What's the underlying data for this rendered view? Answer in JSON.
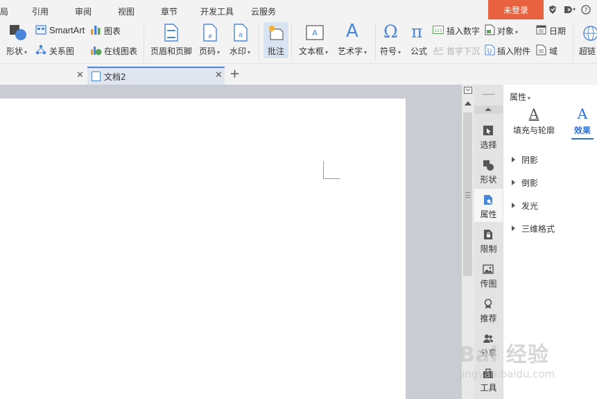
{
  "menu": {
    "items": [
      "布局",
      "引用",
      "审阅",
      "视图",
      "章节",
      "开发工具",
      "云服务"
    ],
    "login_label": "未登录"
  },
  "ribbon": {
    "shape_label": "形状",
    "smartart_label": "SmartArt",
    "chart_label": "图表",
    "relation_label": "关系图",
    "online_chart_label": "在线图表",
    "header_footer_label": "页眉和页脚",
    "page_number_label": "页码",
    "watermark_label": "水印",
    "comment_label": "批注",
    "textbox_label": "文本框",
    "wordart_label": "艺术字",
    "symbol_label": "符号",
    "formula_label": "公式",
    "insert_number_label": "插入数字",
    "object_label": "对象",
    "date_label": "日期",
    "drop_cap_label": "首字下沉",
    "insert_attachment_label": "插入附件",
    "field_label": "域",
    "hyperlink_label": "超链"
  },
  "tabs": {
    "active_title": "文档2"
  },
  "strip": {
    "items": [
      "选择",
      "形状",
      "属性",
      "限制",
      "传图",
      "推荐",
      "分享",
      "工具"
    ]
  },
  "panel": {
    "title": "属性",
    "tab_fill": "填充与轮廓",
    "tab_effect": "效果",
    "sections": [
      "阴影",
      "倒影",
      "发光",
      "三维格式"
    ]
  },
  "watermark": {
    "big": "Bai 经验",
    "small": "jingyan.baidu.com"
  },
  "colors": {
    "accent": "#2e6fd6",
    "login": "#e8623f",
    "doc_bg": "#c9ccd3"
  }
}
